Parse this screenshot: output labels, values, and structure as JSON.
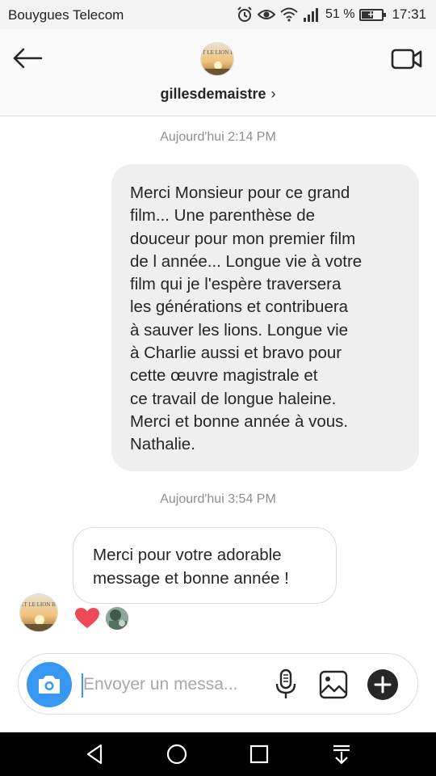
{
  "status_bar": {
    "carrier": "Bouygues Telecom",
    "battery_percent": "51 %",
    "battery_level": 0.51,
    "time": "17:31",
    "icons": [
      "alarm-icon",
      "eye-icon",
      "wifi-icon",
      "signal-icon",
      "battery-charging-icon"
    ]
  },
  "header": {
    "username": "gillesdemaistre",
    "chevron": "›",
    "avatar_caption": "MIA ET LE LION BLANC",
    "icons": [
      "back-arrow-icon",
      "video-call-icon"
    ]
  },
  "conversation": {
    "timestamp_1": "Aujourd'hui 2:14 PM",
    "message_sent": "Merci Monsieur pour ce grand\nfilm... Une parenthèse de\ndouceur pour mon premier film\nde l année... Longue vie à votre\nfilm qui je l'espère traversera\nles générations et contribuera\nà sauver les lions. Longue vie\nà Charlie aussi et bravo pour\ncette œuvre magistrale et\nce travail de longue haleine.\nMerci et bonne année à vous.\nNathalie.",
    "timestamp_2": "Aujourd'hui 3:54 PM",
    "message_received": "Merci pour votre adorable\nmessage et bonne année !",
    "reaction": "heart-icon"
  },
  "composer": {
    "value": "",
    "placeholder": "Envoyer un messa...",
    "icons": [
      "camera-icon",
      "microphone-icon",
      "gallery-icon",
      "plus-icon"
    ]
  },
  "colors": {
    "accent_blue": "#3897f0",
    "heart_red": "#ed4956",
    "bubble_gray": "#efefef",
    "text_dark": "#262626",
    "timestamp_gray": "#8e8e8e"
  },
  "nav_bar": {
    "icons": [
      "back-triangle-icon",
      "home-circle-icon",
      "recents-square-icon",
      "notification-pull-icon"
    ]
  }
}
